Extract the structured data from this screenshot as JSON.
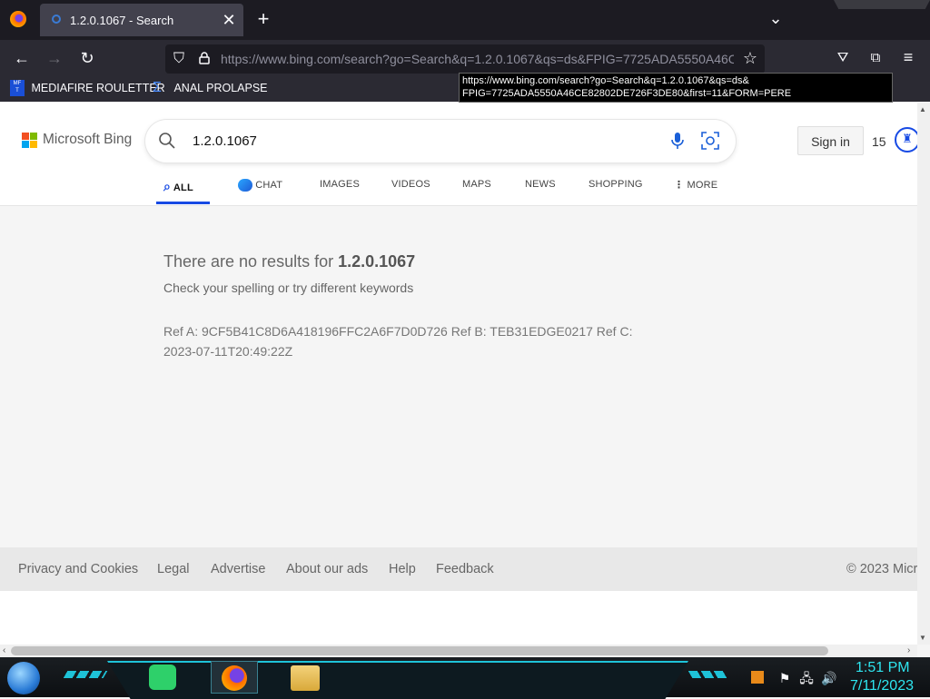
{
  "browser": {
    "tab_title": "1.2.0.1067 - Search",
    "new_tab_label": "+",
    "url": "https://www.bing.com/search?go=Search&q=1.2.0.1067&qs=ds&FPIG=7725ADA5550A46C",
    "tooltip_line1": "https://www.bing.com/search?go=Search&q=1.2.0.1067&qs=ds&",
    "tooltip_line2": "FPIG=7725ADA5550A46CE82802DE726F3DE80&first=11&FORM=PERE",
    "bookmarks": [
      {
        "label": "MEDIAFIRE ROULETTER"
      },
      {
        "label": "ANAL PROLAPSE"
      }
    ]
  },
  "bing": {
    "logo_text": "Microsoft Bing",
    "query": "1.2.0.1067",
    "sign_in": "Sign in",
    "points": "15",
    "tabs": [
      {
        "label": "ALL"
      },
      {
        "label": "CHAT"
      },
      {
        "label": "IMAGES"
      },
      {
        "label": "VIDEOS"
      },
      {
        "label": "MAPS"
      },
      {
        "label": "NEWS"
      },
      {
        "label": "SHOPPING"
      },
      {
        "label": "MORE"
      }
    ]
  },
  "results": {
    "no_results_prefix": "There are no results for ",
    "no_results_query": "1.2.0.1067",
    "suggestion": "Check your spelling or try different keywords",
    "ref_line1": "Ref A: 9CF5B41C8D6A418196FFC2A6F7D0D726 Ref B: TEB31EDGE0217 Ref C:",
    "ref_line2": "2023-07-11T20:49:22Z"
  },
  "footer": {
    "links": [
      {
        "label": "Privacy and Cookies"
      },
      {
        "label": "Legal"
      },
      {
        "label": "Advertise"
      },
      {
        "label": "About our ads"
      },
      {
        "label": "Help"
      },
      {
        "label": "Feedback"
      }
    ],
    "copyright": "© 2023 Micr"
  },
  "taskbar": {
    "time": "1:51 PM",
    "date": "7/11/2023"
  },
  "colors": {
    "bing_accent": "#174ae4",
    "clock": "#2ee6f0",
    "browser_dark": "#2b2a33"
  }
}
